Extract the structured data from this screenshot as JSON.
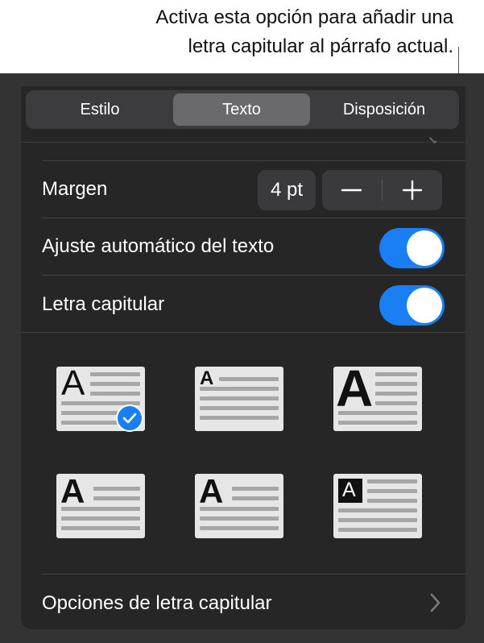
{
  "callout": {
    "line1": "Activa esta opción para añadir una",
    "line2": "letra capitular al párrafo actual."
  },
  "tabs": [
    {
      "label": "Estilo",
      "active": false
    },
    {
      "label": "Texto",
      "active": true
    },
    {
      "label": "Disposición",
      "active": false
    }
  ],
  "margin": {
    "label": "Margen",
    "value": "4 pt"
  },
  "autofit": {
    "label": "Ajuste automático del texto",
    "on": true
  },
  "dropcap": {
    "label": "Letra capitular",
    "on": true
  },
  "dropcap_styles": {
    "glyph": "A",
    "selected_index": 0
  },
  "options_row": {
    "label": "Opciones de letra capitular"
  },
  "colors": {
    "accent": "#1a7ef4",
    "panel": "#262626",
    "control": "#3a3a3c"
  }
}
